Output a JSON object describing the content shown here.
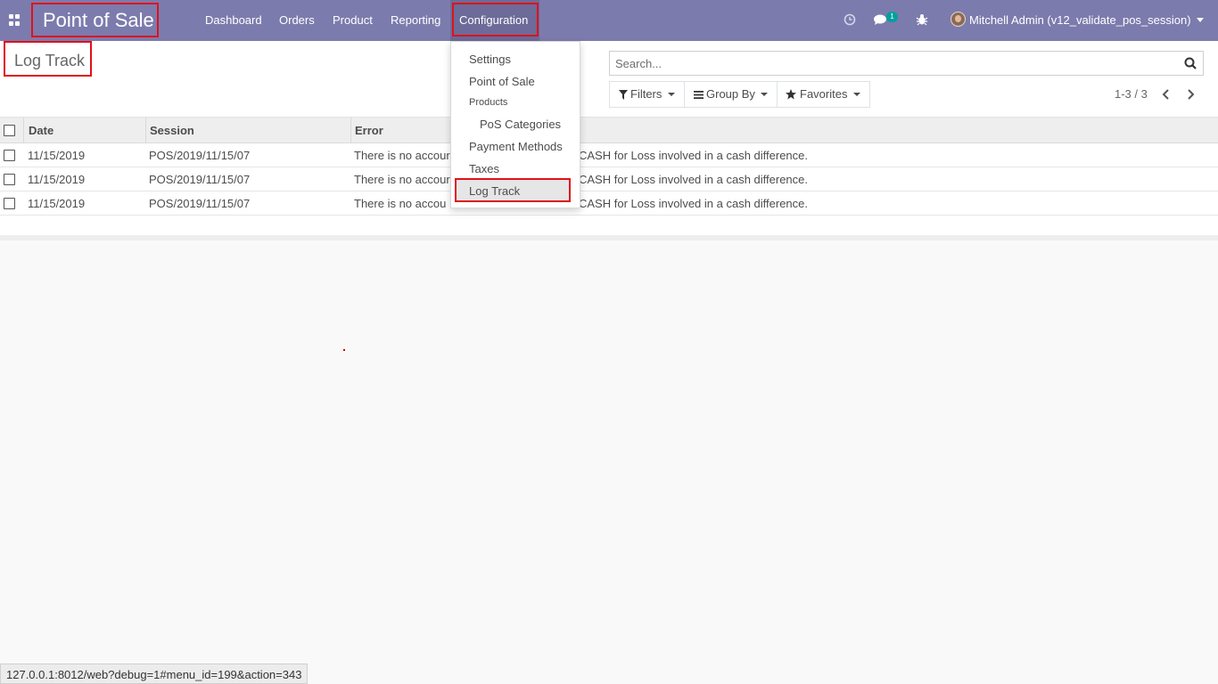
{
  "navbar": {
    "app_title": "Point of Sale",
    "menu": {
      "dashboard": "Dashboard",
      "orders": "Orders",
      "product": "Product",
      "reporting": "Reporting",
      "configuration": "Configuration"
    },
    "messages_count": "1",
    "user": "Mitchell Admin (v12_validate_pos_session)"
  },
  "control_panel": {
    "breadcrumb": "Log Track",
    "search_placeholder": "Search...",
    "filters_label": "Filters",
    "groupby_label": "Group By",
    "favorites_label": "Favorites",
    "pager": "1-3 / 3"
  },
  "list": {
    "columns": {
      "date": "Date",
      "session": "Session",
      "error": "Error"
    },
    "rows": [
      {
        "date": "11/15/2019",
        "session": "POS/2019/11/15/07",
        "error_left": "There is no accour",
        "error_right": "CASH for Loss involved in a cash difference."
      },
      {
        "date": "11/15/2019",
        "session": "POS/2019/11/15/07",
        "error_left": "There is no accour",
        "error_right": "CASH for Loss involved in a cash difference."
      },
      {
        "date": "11/15/2019",
        "session": "POS/2019/11/15/07",
        "error_left": "There is no accou",
        "error_right": "CASH for Loss involved in a cash difference."
      }
    ]
  },
  "config_dropdown": {
    "settings": "Settings",
    "point_of_sale": "Point of Sale",
    "products_header": "Products",
    "pos_categories": "PoS Categories",
    "payment_methods": "Payment Methods",
    "taxes": "Taxes",
    "log_track": "Log Track"
  },
  "status_bar": {
    "url": "127.0.0.1:8012/web?debug=1#menu_id=199&action=343"
  },
  "colors": {
    "navbar": "#7c7bad",
    "highlight_border": "#e0111b",
    "badge": "#00a09d"
  }
}
